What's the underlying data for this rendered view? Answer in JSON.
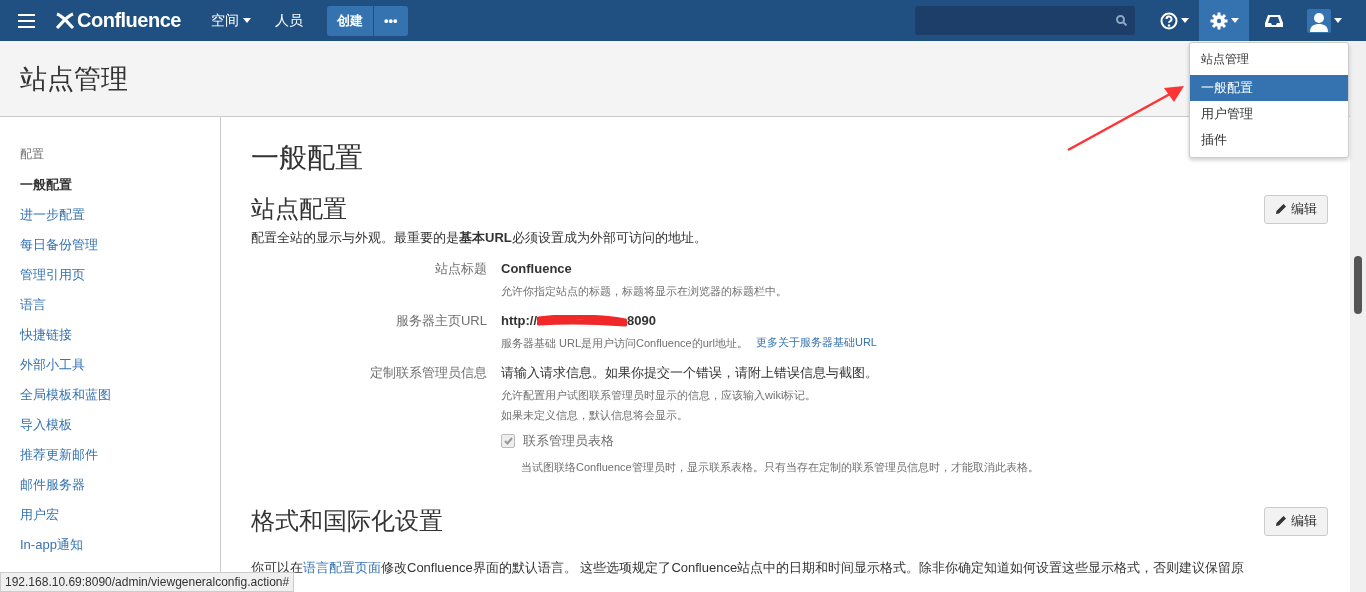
{
  "nav": {
    "logo": "Confluence",
    "links": [
      {
        "label": "空间",
        "caret": true
      },
      {
        "label": "人员",
        "caret": false
      }
    ],
    "create": "创建",
    "more": "•••",
    "icons": [
      {
        "kind": "help",
        "selected": false
      },
      {
        "kind": "settings",
        "selected": true
      },
      {
        "kind": "inbox",
        "selected": false
      },
      {
        "kind": "user",
        "selected": false
      }
    ]
  },
  "dropdown": {
    "heading": "站点管理",
    "items": [
      {
        "label": "一般配置",
        "selected": true
      },
      {
        "label": "用户管理",
        "selected": false
      },
      {
        "label": "插件",
        "selected": false
      }
    ]
  },
  "header": {
    "title": "站点管理"
  },
  "sidebar": {
    "heading": "配置",
    "items": [
      {
        "label": "一般配置",
        "selected": true
      },
      {
        "label": "进一步配置",
        "selected": false
      },
      {
        "label": "每日备份管理",
        "selected": false
      },
      {
        "label": "管理引用页",
        "selected": false
      },
      {
        "label": "语言",
        "selected": false
      },
      {
        "label": "快捷链接",
        "selected": false
      },
      {
        "label": "外部小工具",
        "selected": false
      },
      {
        "label": "全局模板和蓝图",
        "selected": false
      },
      {
        "label": "导入模板",
        "selected": false
      },
      {
        "label": "推荐更新邮件",
        "selected": false
      },
      {
        "label": "邮件服务器",
        "selected": false
      },
      {
        "label": "用户宏",
        "selected": false
      },
      {
        "label": "In-app通知",
        "selected": false
      }
    ]
  },
  "main": {
    "title": "一般配置",
    "sections": [
      {
        "title": "站点配置",
        "edit": "编辑",
        "intro": "配置全站的显示与外观。最重要的是**基本URL**必须设置成为外部可访问的地址。",
        "fields": [
          {
            "kind": "text",
            "label": "站点标题",
            "value": "Confluence",
            "help": [
              "允许你指定站点的标题，标题将显示在浏览器的标题栏中。"
            ]
          },
          {
            "kind": "url",
            "label": "服务器主页URL",
            "value": "http://",
            "value_end": "8090",
            "help": [
              "服务器基础 URL是用户访问Confluence的url地址。"
            ],
            "link": "更多关于服务器基础URL"
          },
          {
            "kind": "checkbox",
            "label": "定制联系管理员信息",
            "value": "请输入请求信息。如果你提交一个错误，请附上错误信息与截图。",
            "help": [
              "允许配置用户试图联系管理员时显示的信息，应该输入wiki标记。",
              "如果未定义信息，默认信息将会显示。"
            ],
            "checkbox": {
              "label": "联系管理员表格",
              "checked": true,
              "disabled": true,
              "help": "当试图联络Confluence管理员时，显示联系表格。只有当存在定制的联系管理员信息时，才能取消此表格。"
            }
          }
        ]
      },
      {
        "title": "格式和国际化设置",
        "edit": "编辑",
        "intro_start": "你可以在",
        "intro_link": "语言配置页面",
        "intro_end": "修改Confluence界面的默认语言。 这些选项规定了Confluence站点中的日期和时间显示格式。除非你确定知道如何设置这些显示格式，否则建议保留原"
      }
    ]
  },
  "status_bar": "192.168.10.69:8090/admin/viewgeneralconfig.action#"
}
